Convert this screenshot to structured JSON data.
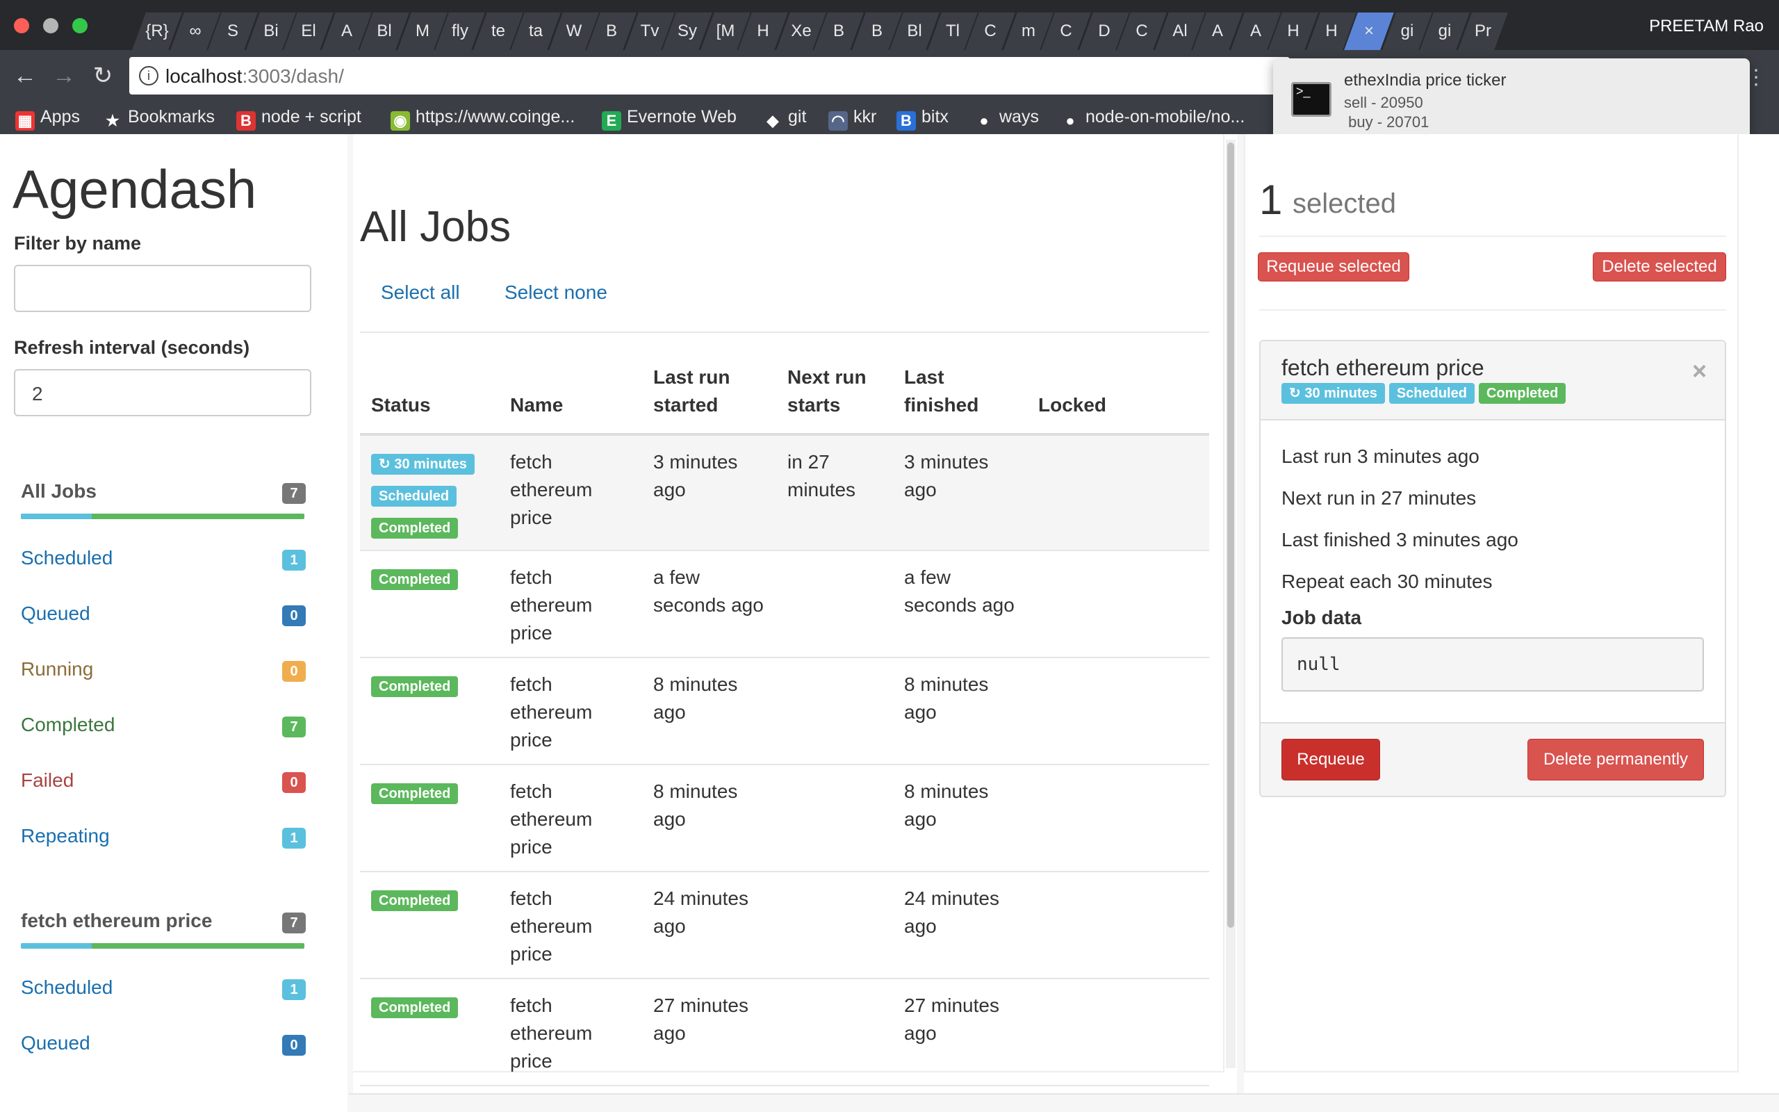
{
  "browser": {
    "tabs": [
      "{R}",
      "∞",
      "S",
      "Bi",
      "El",
      "A",
      "Bl",
      "M",
      "fly",
      "te",
      "ta",
      "W",
      "B",
      "Tv",
      "Sy",
      "[M",
      "H",
      "Xe",
      "B",
      "B",
      "Bl",
      "Tl",
      "C",
      "m",
      "C",
      "D",
      "C",
      "Al",
      "A",
      "A",
      "H",
      "H",
      "×",
      "gi",
      "gi",
      "Pr"
    ],
    "profile": "PREETAM Rao",
    "url_host": "localhost",
    "url_rest": ":3003/dash/",
    "bookmarks": [
      "Apps",
      "Bookmarks",
      "node + script",
      "https://www.coinge...",
      "Evernote Web",
      "git",
      "kkr",
      "bitx",
      "ways",
      "node-on-mobile/no..."
    ]
  },
  "notification": {
    "title": "ethexIndia price ticker",
    "line1": "sell - 20950",
    "line2": " buy - 20701"
  },
  "sidebar": {
    "title": "Agendash",
    "filter_label": "Filter by name",
    "filter_value": "",
    "refresh_label": "Refresh interval (seconds)",
    "refresh_value": "2",
    "all_jobs": {
      "label": "All Jobs",
      "count": "7",
      "queued_fraction": 0.25
    },
    "status_items": [
      {
        "label": "Scheduled",
        "count": "1",
        "color": "#1a6fae",
        "badge": "#5bc0de"
      },
      {
        "label": "Queued",
        "count": "0",
        "color": "#1a6fae",
        "badge": "#337ab7"
      },
      {
        "label": "Running",
        "count": "0",
        "color": "#8a6d3b",
        "badge": "#f0ad4e"
      },
      {
        "label": "Completed",
        "count": "7",
        "color": "#3c763d",
        "badge": "#5cb85c"
      },
      {
        "label": "Failed",
        "count": "0",
        "color": "#a94442",
        "badge": "#d9534f"
      },
      {
        "label": "Repeating",
        "count": "1",
        "color": "#1a6fae",
        "badge": "#5bc0de"
      }
    ],
    "group": {
      "label": "fetch ethereum price",
      "count": "7",
      "queued_fraction": 0.25
    },
    "group_items": [
      {
        "label": "Scheduled",
        "count": "1",
        "color": "#1a6fae",
        "badge": "#5bc0de"
      },
      {
        "label": "Queued",
        "count": "0",
        "color": "#1a6fae",
        "badge": "#337ab7"
      }
    ]
  },
  "main": {
    "title": "All Jobs",
    "select_all": "Select all",
    "select_none": "Select none",
    "columns": [
      "Status",
      "Name",
      "Last run started",
      "Next run starts",
      "Last finished",
      "Locked"
    ],
    "rows": [
      {
        "selected": true,
        "badges": [
          {
            "text": "30 minutes",
            "kind": "info",
            "repeat": true
          },
          {
            "text": "Scheduled",
            "kind": "info"
          },
          {
            "text": "Completed",
            "kind": "success"
          }
        ],
        "name": "fetch ethereum price",
        "last_run": "3 minutes ago",
        "next_run": "in 27 minutes",
        "last_finished": "3 minutes ago",
        "locked": ""
      },
      {
        "selected": false,
        "badges": [
          {
            "text": "Completed",
            "kind": "success"
          }
        ],
        "name": "fetch ethereum price",
        "last_run": "a few seconds ago",
        "next_run": "",
        "last_finished": "a few seconds ago",
        "locked": ""
      },
      {
        "selected": false,
        "badges": [
          {
            "text": "Completed",
            "kind": "success"
          }
        ],
        "name": "fetch ethereum price",
        "last_run": "8 minutes ago",
        "next_run": "",
        "last_finished": "8 minutes ago",
        "locked": ""
      },
      {
        "selected": false,
        "badges": [
          {
            "text": "Completed",
            "kind": "success"
          }
        ],
        "name": "fetch ethereum price",
        "last_run": "8 minutes ago",
        "next_run": "",
        "last_finished": "8 minutes ago",
        "locked": ""
      },
      {
        "selected": false,
        "badges": [
          {
            "text": "Completed",
            "kind": "success"
          }
        ],
        "name": "fetch ethereum price",
        "last_run": "24 minutes ago",
        "next_run": "",
        "last_finished": "24 minutes ago",
        "locked": ""
      },
      {
        "selected": false,
        "badges": [
          {
            "text": "Completed",
            "kind": "success"
          }
        ],
        "name": "fetch ethereum price",
        "last_run": "27 minutes ago",
        "next_run": "",
        "last_finished": "27 minutes ago",
        "locked": ""
      }
    ]
  },
  "detail": {
    "selected_count": "1",
    "selected_label": "selected",
    "requeue_selected": "Requeue selected",
    "delete_selected": "Delete selected",
    "job_title": "fetch ethereum price",
    "badges": [
      {
        "text": "30 minutes",
        "kind": "info",
        "repeat": true
      },
      {
        "text": "Scheduled",
        "kind": "info"
      },
      {
        "text": "Completed",
        "kind": "success"
      }
    ],
    "close": "×",
    "last_run": "Last run 3 minutes ago",
    "next_run": "Next run in 27 minutes",
    "last_finished": "Last finished 3 minutes ago",
    "repeat": "Repeat each 30 minutes",
    "job_data_label": "Job data",
    "job_data": "null",
    "requeue": "Requeue",
    "delete_permanently": "Delete permanently"
  }
}
